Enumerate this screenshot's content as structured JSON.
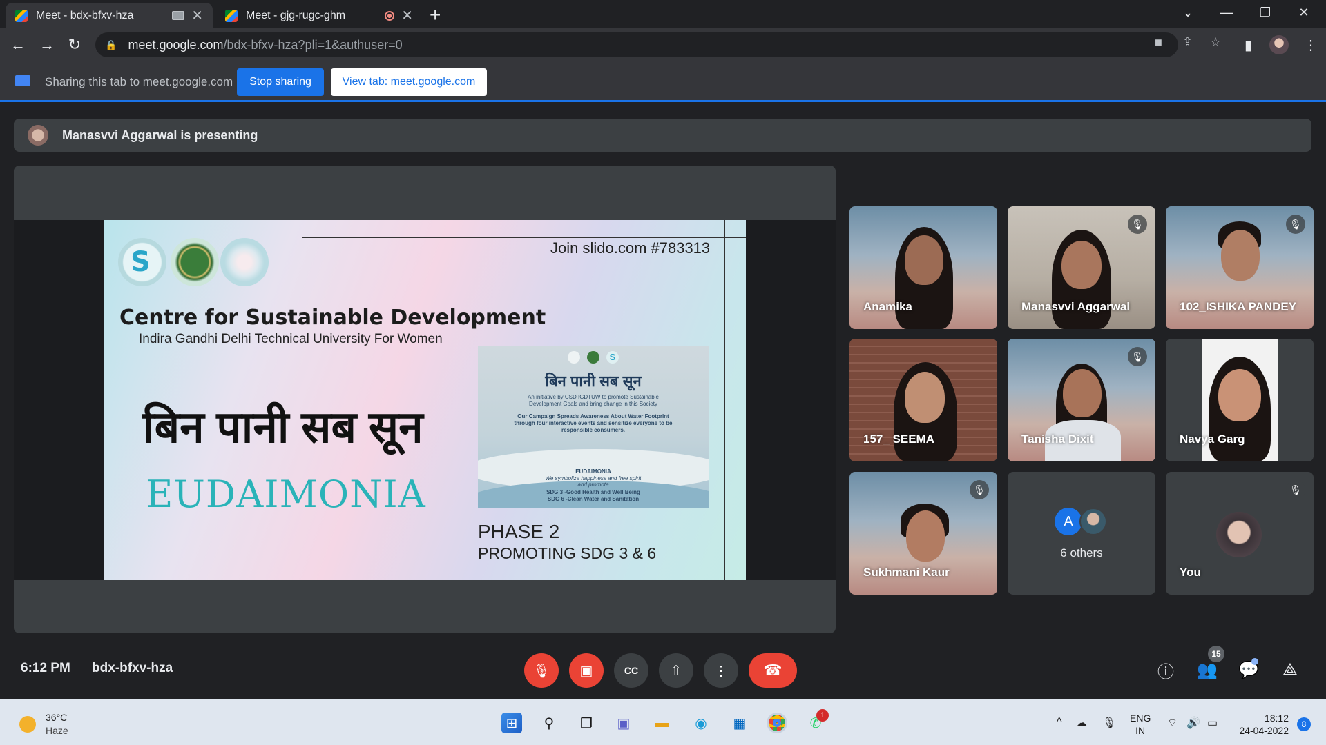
{
  "browser": {
    "tabs": [
      {
        "title": "Meet - bdx-bfxv-hza",
        "active": true
      },
      {
        "title": "Meet - gjg-rugc-ghm",
        "active": false
      }
    ],
    "url_host": "meet.google.com",
    "url_path": "/bdx-bfxv-hza?pli=1&authuser=0"
  },
  "sharing": {
    "text": "Sharing this tab to meet.google.com",
    "stop_label": "Stop sharing",
    "view_label": "View tab: meet.google.com"
  },
  "meet": {
    "presenting_text": "Manasvvi Aggarwal is presenting",
    "slide": {
      "slido": "Join slido.com #783313",
      "centre": "Centre for Sustainable Development",
      "university": "Indira Gandhi Delhi Technical University For Women",
      "hindi": "बिन पानी सब सून",
      "eudaimonia": "EUDAIMONIA",
      "poster_title": "बिन पानी सब सून",
      "poster_line1": "An initiative by CSD IGDTUW to promote Sustainable",
      "poster_line2": "Development Goals and bring change in this Society",
      "poster_line3": "Our Campaign Spreads Awareness About Water Footprint",
      "poster_line4": "through four interactive events and sensitize everyone to be",
      "poster_line5": "responsible consumers.",
      "poster_eud": "EUDAIMONIA",
      "poster_tag1": "We symbolize happiness and free spirit",
      "poster_tag2": "and promote",
      "poster_sdg1": "SDG 3 -Good Health and Well Being",
      "poster_sdg2": "SDG 6 -Clean Water and Sanitation",
      "phase": "PHASE 2",
      "promoting": "PROMOTING SDG 3 & 6"
    },
    "participants": [
      {
        "name": "Anamika",
        "muted": false
      },
      {
        "name": "Manasvvi Aggarwal",
        "muted": true
      },
      {
        "name": "102_ISHIKA PANDEY",
        "muted": true
      },
      {
        "name": "157_ SEEMA",
        "muted": false
      },
      {
        "name": "Tanisha Dixit",
        "muted": true
      },
      {
        "name": "Navya Garg",
        "muted": false
      },
      {
        "name": "Sukhmani Kaur",
        "muted": true
      },
      {
        "name": "You",
        "muted": true
      }
    ],
    "others": {
      "initial": "A",
      "label": "6 others"
    },
    "time": "6:12 PM",
    "meeting_code": "bdx-bfxv-hza",
    "people_count": "15"
  },
  "taskbar": {
    "temperature": "36°C",
    "weather": "Haze",
    "lang1": "ENG",
    "lang2": "IN",
    "time": "18:12",
    "date": "24-04-2022",
    "notifications": "8",
    "whatsapp_badge": "1"
  },
  "colors": {
    "accent": "#1a73e8",
    "danger": "#ea4335",
    "surface": "#3c4043",
    "background": "#202124"
  }
}
